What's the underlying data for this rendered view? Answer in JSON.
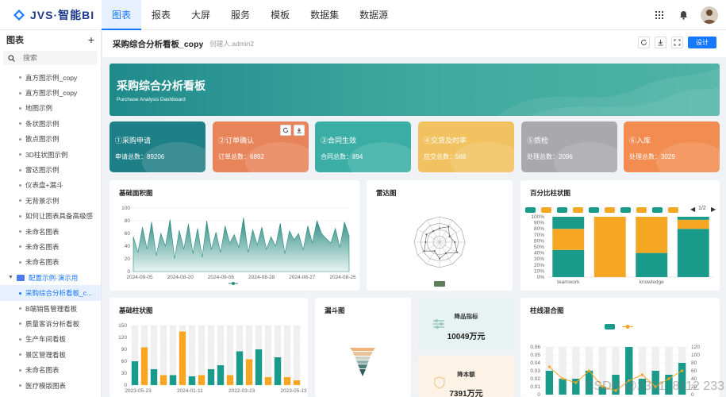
{
  "app": {
    "name": "JVS·智能BI"
  },
  "nav": {
    "items": [
      "图表",
      "报表",
      "大屏",
      "服务",
      "模板",
      "数据集",
      "数据源"
    ]
  },
  "sidebar": {
    "title": "图表",
    "add_label": "+",
    "search_placeholder": "搜索",
    "items": [
      "直方图示例_copy",
      "直方图示例_copy",
      "地图示例",
      "条状图示例",
      "散点图示例",
      "3D柱状图示例",
      "雷达图示例",
      "仪表盘+漏斗",
      "无背景示例",
      "如何让图表具备高级感",
      "未命名图表",
      "未命名图表",
      "未命名图表"
    ],
    "folder": "配置示例-演示用",
    "folder_items": [
      "采购综合分析看板_c...",
      "B端销售管理看板",
      "质量客诉分析看板",
      "生产车间看板",
      "景区管理看板",
      "未命名图表",
      "医疗模版图表"
    ]
  },
  "header": {
    "title": "采购综合分析看板_copy",
    "creator": "创建人:admin2",
    "design_label": "设计"
  },
  "banner": {
    "title": "采购综合分析看板",
    "subtitle": "Purchase Analysis Dashboard"
  },
  "kpis": [
    {
      "title": "①采购申请",
      "sub": "申请总数：89206",
      "color": "#1f7f86"
    },
    {
      "title": "②订单确认",
      "sub": "订单总数：6892",
      "color": "#e8845a"
    },
    {
      "title": "③合同生效",
      "sub": "合同总数：894",
      "color": "#3aaea4"
    },
    {
      "title": "④交货及时率",
      "sub": "应交总数：568",
      "color": "#f2c261"
    },
    {
      "title": "⑤质检",
      "sub": "处理总数：2096",
      "color": "#a9a9ac"
    },
    {
      "title": "⑥入库",
      "sub": "处理总数：3029",
      "color": "#f28c50"
    }
  ],
  "panels": {
    "area": {
      "title": "基础面积图"
    },
    "radar": {
      "title": "雷达图"
    },
    "percent": {
      "title": "百分比柱状图",
      "page": "1/2"
    },
    "bar": {
      "title": "基础柱状图"
    },
    "funnel": {
      "title": "漏斗图"
    },
    "mixed": {
      "title": "柱线混合图"
    }
  },
  "stats": [
    {
      "label": "降品指标",
      "value": "10049万元"
    },
    {
      "label": "降本额",
      "value": "7391万元"
    }
  ],
  "watermark": "演示",
  "footer_mark": "CSDN @2301_8112 233",
  "colors": {
    "primary": "#1677ff",
    "teal": "#1a9a8a",
    "orange": "#f5a623"
  },
  "chart_data": [
    {
      "type": "area",
      "title": "基础面积图",
      "x_ticks": [
        "2024-09-05",
        "2024-08-20",
        "2024-09-06",
        "2024-08-28",
        "2024-08-27",
        "2024-08-26"
      ],
      "ylim": [
        0,
        100
      ],
      "y_ticks": [
        0,
        20,
        40,
        60,
        80,
        100
      ],
      "values": [
        55,
        30,
        70,
        35,
        78,
        25,
        60,
        40,
        82,
        20,
        65,
        35,
        75,
        28,
        68,
        22,
        80,
        35,
        62,
        30,
        72,
        45,
        58,
        38,
        85,
        30,
        66,
        42,
        70,
        35,
        55,
        40,
        76,
        28,
        64,
        50,
        60,
        34,
        72,
        45,
        80,
        60,
        52,
        45,
        68,
        38,
        78,
        56
      ]
    },
    {
      "type": "radar",
      "title": "雷达图",
      "axes": 12,
      "values": [
        0.55,
        0.7,
        0.45,
        0.6,
        0.8,
        0.5,
        0.65,
        0.4,
        0.7,
        0.55,
        0.6,
        0.5
      ]
    },
    {
      "type": "bar",
      "title": "百分比柱状图",
      "categories": [
        "teamwork",
        "",
        "knowledge",
        ""
      ],
      "ylim": [
        0,
        100
      ],
      "y_ticks": [
        "0%",
        "10%",
        "20%",
        "30%",
        "40%",
        "50%",
        "60%",
        "70%",
        "80%",
        "90%",
        "100%"
      ],
      "series": [
        {
          "color": "#1a9a8a",
          "values": [
            45,
            0,
            40,
            80
          ]
        },
        {
          "color": "#f5a623",
          "values": [
            35,
            100,
            60,
            15
          ]
        },
        {
          "color": "#1a9a8a",
          "values": [
            20,
            0,
            0,
            5
          ]
        }
      ]
    },
    {
      "type": "bar",
      "title": "基础柱状图",
      "ylim": [
        0,
        150
      ],
      "y_ticks": [
        0,
        30,
        60,
        90,
        120,
        150
      ],
      "x_ticks": [
        "2023-05-23",
        "2024-01-11",
        "2022-03-23",
        "2023-05-13"
      ],
      "values": [
        60,
        95,
        40,
        25,
        25,
        135,
        22,
        25,
        40,
        50,
        25,
        85,
        65,
        90,
        20,
        70,
        20,
        12
      ],
      "colors": [
        "#1a9a8a",
        "#f5a623",
        "#1a9a8a",
        "#f5a623",
        "#1a9a8a",
        "#f5a623",
        "#1a9a8a",
        "#f5a623",
        "#1a9a8a",
        "#1a9a8a",
        "#f5a623",
        "#1a9a8a",
        "#f5a623",
        "#1a9a8a",
        "#f5a623",
        "#1a9a8a",
        "#f5a623",
        "#f5a623"
      ]
    },
    {
      "type": "bar",
      "title": "柱线混合图",
      "y_ticks": [
        0,
        0.01,
        0.02,
        0.03,
        0.04,
        0.05,
        0.06
      ],
      "y2_ticks": [
        0,
        20,
        40,
        60,
        80,
        100,
        120
      ],
      "bars": [
        0.03,
        0.02,
        0.02,
        0.03,
        0.01,
        0.025,
        0.06,
        0.02,
        0.03,
        0.025,
        0.04
      ],
      "line": [
        70,
        40,
        30,
        60,
        20,
        10,
        35,
        50,
        20,
        40,
        60
      ]
    }
  ]
}
